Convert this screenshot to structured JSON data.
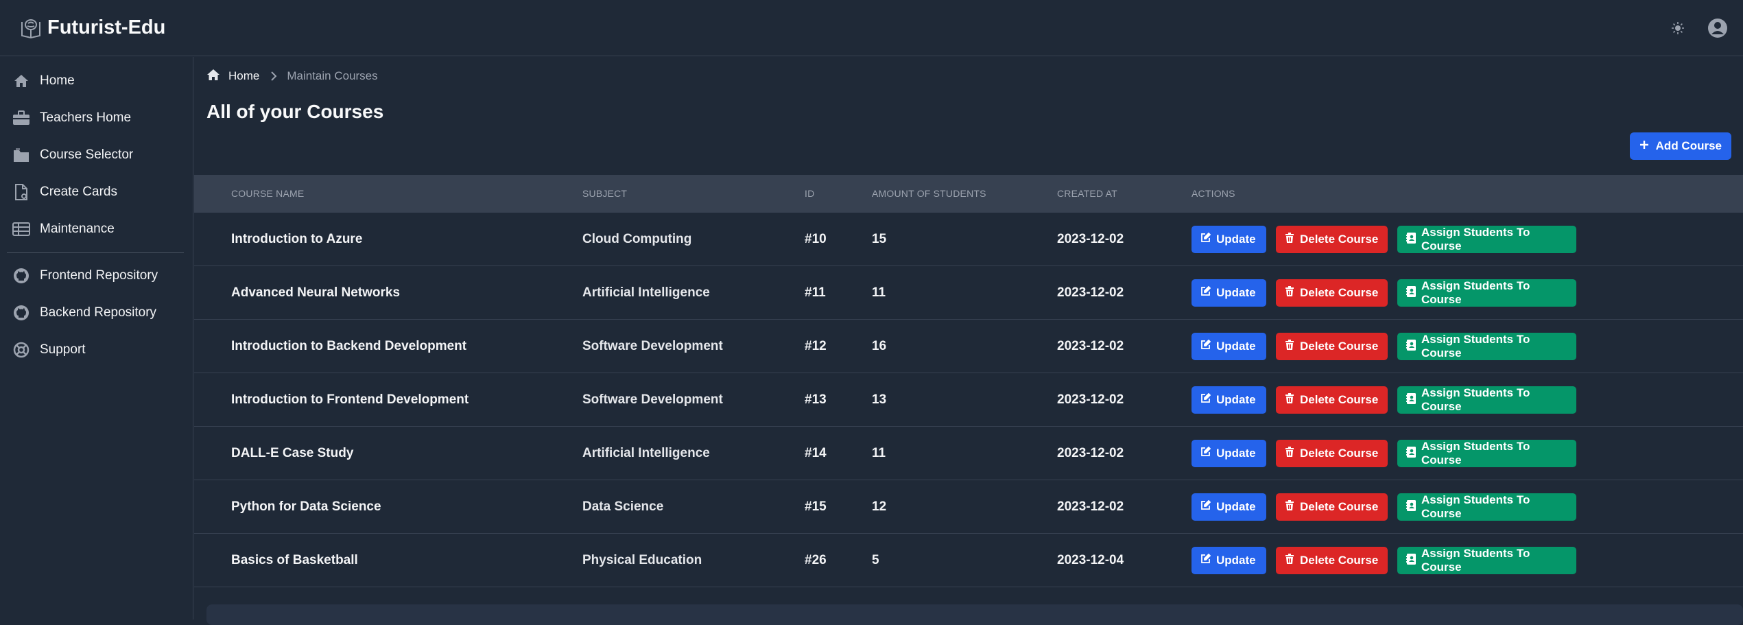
{
  "app": {
    "name": "Futurist-Edu"
  },
  "sidebar": {
    "items": [
      {
        "label": "Home",
        "icon": "home-icon"
      },
      {
        "label": "Teachers Home",
        "icon": "briefcase-icon"
      },
      {
        "label": "Course Selector",
        "icon": "folder-icon"
      },
      {
        "label": "Create Cards",
        "icon": "document-icon"
      },
      {
        "label": "Maintenance",
        "icon": "table-icon"
      },
      {
        "label": "Frontend Repository",
        "icon": "github-icon"
      },
      {
        "label": "Backend Repository",
        "icon": "github-icon"
      },
      {
        "label": "Support",
        "icon": "lifebuoy-icon"
      }
    ]
  },
  "breadcrumb": {
    "home": "Home",
    "current": "Maintain Courses"
  },
  "page": {
    "title": "All of your Courses",
    "add_button": "Add Course"
  },
  "table": {
    "headers": [
      "Course Name",
      "Subject",
      "ID",
      "Amount of Students",
      "Created At",
      "Actions"
    ],
    "action_labels": {
      "update": "Update",
      "delete": "Delete Course",
      "assign": "Assign Students To Course"
    },
    "rows": [
      {
        "name": "Introduction to Azure",
        "subject": "Cloud Computing",
        "id": "#10",
        "students": "15",
        "created": "2023-12-02"
      },
      {
        "name": "Advanced Neural Networks",
        "subject": "Artificial Intelligence",
        "id": "#11",
        "students": "11",
        "created": "2023-12-02"
      },
      {
        "name": "Introduction to Backend Development",
        "subject": "Software Development",
        "id": "#12",
        "students": "16",
        "created": "2023-12-02"
      },
      {
        "name": "Introduction to Frontend Development",
        "subject": "Software Development",
        "id": "#13",
        "students": "13",
        "created": "2023-12-02"
      },
      {
        "name": "DALL-E Case Study",
        "subject": "Artificial Intelligence",
        "id": "#14",
        "students": "11",
        "created": "2023-12-02"
      },
      {
        "name": "Python for Data Science",
        "subject": "Data Science",
        "id": "#15",
        "students": "12",
        "created": "2023-12-02"
      },
      {
        "name": "Basics of Basketball",
        "subject": "Physical Education",
        "id": "#26",
        "students": "5",
        "created": "2023-12-04"
      }
    ]
  },
  "colors": {
    "background": "#1f2937",
    "header_row": "#374151",
    "primary": "#2563eb",
    "danger": "#dc2626",
    "success": "#059669"
  }
}
